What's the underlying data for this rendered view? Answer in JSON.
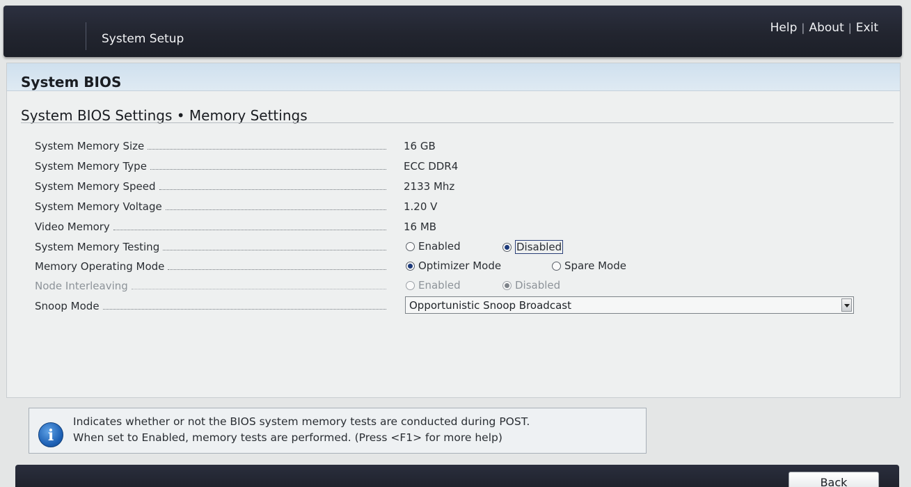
{
  "header": {
    "app_title": "System Setup",
    "links": {
      "help": "Help",
      "about": "About",
      "exit": "Exit",
      "separator": "|"
    }
  },
  "panel": {
    "title": "System BIOS",
    "subtitle": "System BIOS Settings • Memory Settings"
  },
  "settings": {
    "memory_size": {
      "label": "System Memory Size",
      "value": "16 GB"
    },
    "memory_type": {
      "label": "System Memory Type",
      "value": "ECC DDR4"
    },
    "memory_speed": {
      "label": "System Memory Speed",
      "value": "2133 Mhz"
    },
    "memory_voltage": {
      "label": "System Memory Voltage",
      "value": "1.20 V"
    },
    "video_memory": {
      "label": "Video Memory",
      "value": "16 MB"
    },
    "memory_testing": {
      "label": "System Memory Testing",
      "options": [
        "Enabled",
        "Disabled"
      ],
      "selected": "Disabled"
    },
    "operating_mode": {
      "label": "Memory Operating Mode",
      "options": [
        "Optimizer Mode",
        "Spare Mode"
      ],
      "selected": "Optimizer Mode"
    },
    "node_interleaving": {
      "label": "Node Interleaving",
      "options": [
        "Enabled",
        "Disabled"
      ],
      "selected": "Disabled",
      "disabled": true
    },
    "snoop_mode": {
      "label": "Snoop Mode",
      "selected": "Opportunistic Snoop Broadcast"
    }
  },
  "help_box": {
    "line1": "Indicates whether or not the BIOS system memory tests are conducted during POST.",
    "line2": "When set to Enabled, memory tests are performed. (Press <F1> for more help)",
    "icon": "info-icon"
  },
  "footer": {
    "back_label": "Back"
  }
}
